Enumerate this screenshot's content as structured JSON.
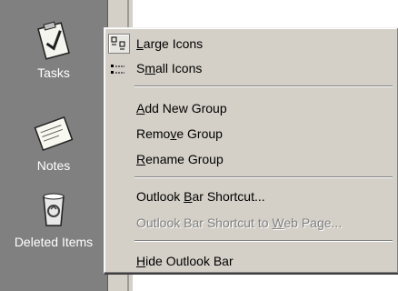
{
  "outlook_bar": {
    "shortcuts": [
      {
        "label": "Tasks",
        "icon": "tasks-clipboard-icon"
      },
      {
        "label": "Notes",
        "icon": "notes-icon"
      },
      {
        "label": "Deleted Items",
        "icon": "recycle-bin-icon"
      }
    ]
  },
  "menu": {
    "large_icons": {
      "pre": "",
      "u": "L",
      "post": "arge Icons",
      "icon": "large-icons-icon",
      "checked": true
    },
    "small_icons": {
      "pre": "S",
      "u": "m",
      "post": "all Icons",
      "icon": "small-icons-icon"
    },
    "add_new_group": {
      "pre": "",
      "u": "A",
      "post": "dd New Group"
    },
    "remove_group": {
      "pre": "Remo",
      "u": "v",
      "post": "e Group"
    },
    "rename_group": {
      "pre": "",
      "u": "R",
      "post": "ename Group"
    },
    "outlook_bar_shortcut": {
      "pre": "Outlook ",
      "u": "B",
      "post": "ar Shortcut..."
    },
    "outlook_bar_shortcut_web": {
      "pre": "Outlook Bar Shortcut to ",
      "u": "W",
      "post": "eb Page...",
      "disabled": true
    },
    "hide_outlook_bar": {
      "pre": "",
      "u": "H",
      "post": "ide Outlook Bar"
    }
  },
  "colors": {
    "bar_bg": "#808080",
    "menu_bg": "#d4d0c8",
    "disabled_text": "#808080"
  }
}
